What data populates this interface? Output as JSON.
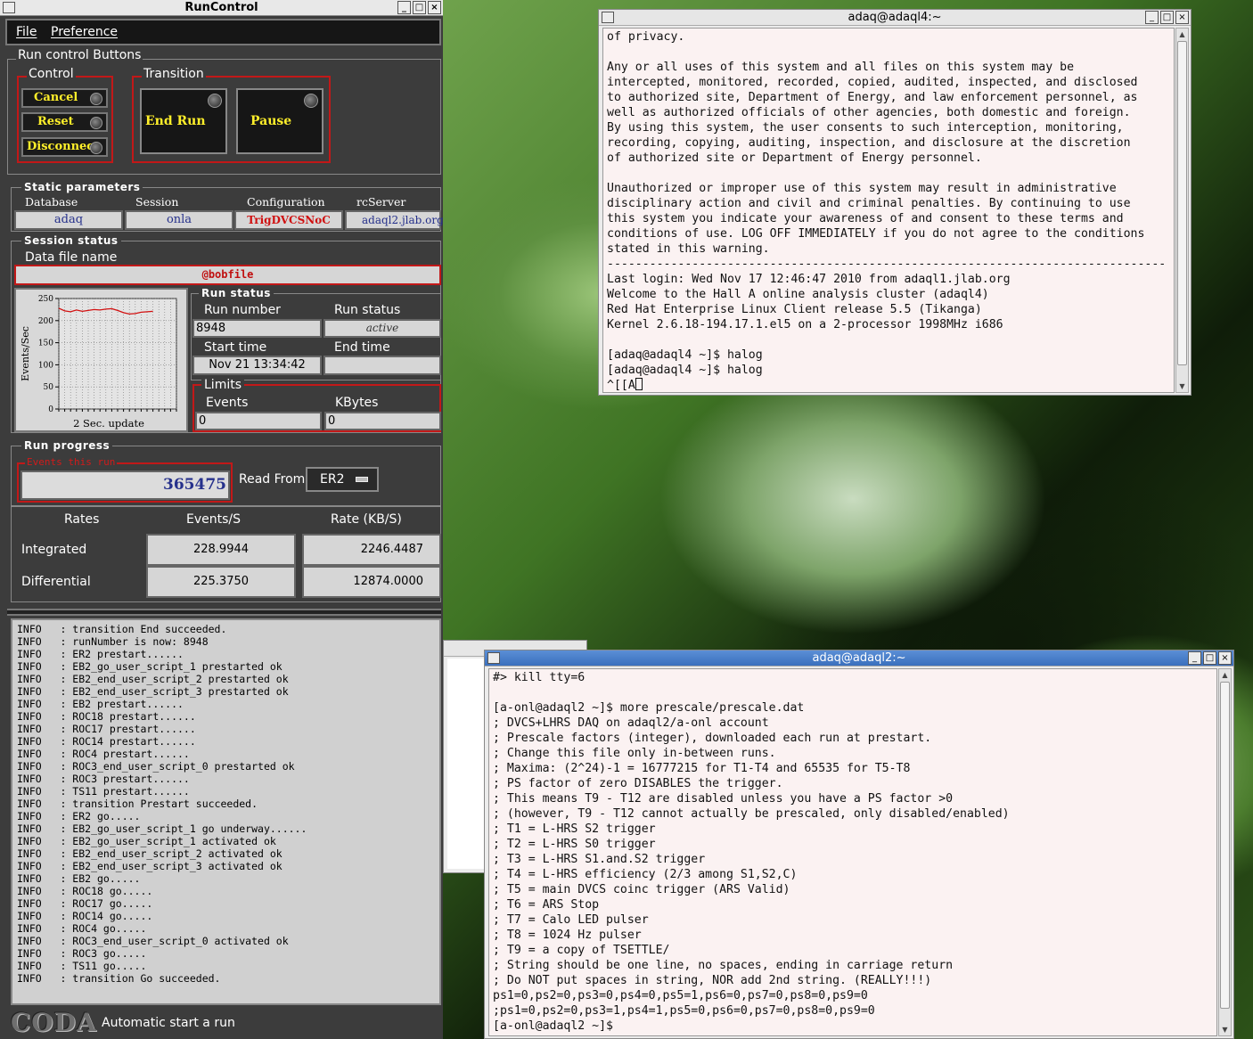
{
  "runcontrol": {
    "title": "RunControl",
    "menu": [
      "File",
      "Preference"
    ],
    "run_control_buttons": "Run control Buttons",
    "control": {
      "label": "Control",
      "buttons": [
        "Cancel",
        "Reset",
        "Disconnect"
      ]
    },
    "transition": {
      "label": "Transition",
      "buttons": [
        "End Run",
        "Pause"
      ]
    },
    "static_params": {
      "label": "Static parameters",
      "database_label": "Database",
      "database": "adaq",
      "session_label": "Session",
      "session": "onla",
      "config_label": "Configuration",
      "config": "TrigDVCSNoC",
      "rcserver_label": "rcServer",
      "rcserver": "adaql2.jlab.org"
    },
    "session_status": {
      "label": "Session status",
      "datafile_label": "Data file name",
      "datafile": "@bobfile"
    },
    "chart": {
      "ylabel": "Events/Sec",
      "footer": "2 Sec. update"
    },
    "run_status": {
      "label": "Run status",
      "run_number_label": "Run number",
      "run_number": "8948",
      "status_label": "Run status",
      "status": "active",
      "start_label": "Start time",
      "start": "Nov 21 13:34:42",
      "end_label": "End time",
      "end": "",
      "limits_label": "Limits",
      "events_label": "Events",
      "events": "0",
      "kbytes_label": "KBytes",
      "kbytes": "0"
    },
    "run_progress": {
      "label": "Run progress",
      "events_label": "Events this run",
      "events": "365475",
      "read_from_label": "Read From:",
      "read_from": "ER2"
    },
    "rates": {
      "header": [
        "Rates",
        "Events/S",
        "Rate (KB/S)"
      ],
      "rows": [
        {
          "name": "Integrated",
          "events": "228.9944",
          "rate": "2246.4487"
        },
        {
          "name": "Differential",
          "events": "225.3750",
          "rate": "12874.0000"
        }
      ]
    },
    "log": [
      "INFO   : transition End succeeded.",
      "INFO   : runNumber is now: 8948",
      "INFO   : ER2 prestart......",
      "INFO   : EB2_go_user_script_1 prestarted ok",
      "INFO   : EB2_end_user_script_2 prestarted ok",
      "INFO   : EB2_end_user_script_3 prestarted ok",
      "INFO   : EB2 prestart......",
      "INFO   : ROC18 prestart......",
      "INFO   : ROC17 prestart......",
      "INFO   : ROC14 prestart......",
      "INFO   : ROC4 prestart......",
      "INFO   : ROC3_end_user_script_0 prestarted ok",
      "INFO   : ROC3 prestart......",
      "INFO   : TS11 prestart......",
      "INFO   : transition Prestart succeeded.",
      "INFO   : ER2 go.....",
      "INFO   : EB2_go_user_script_1 go underway......",
      "INFO   : EB2_go_user_script_1 activated ok",
      "INFO   : EB2_end_user_script_2 activated ok",
      "INFO   : EB2_end_user_script_3 activated ok",
      "INFO   : EB2 go.....",
      "INFO   : ROC18 go.....",
      "INFO   : ROC17 go.....",
      "INFO   : ROC14 go.....",
      "INFO   : ROC4 go.....",
      "INFO   : ROC3_end_user_script_0 activated ok",
      "INFO   : ROC3 go.....",
      "INFO   : TS11 go.....",
      "INFO   : transition Go succeeded."
    ],
    "coda_logo": "CODA",
    "footer_status": "Automatic start a run"
  },
  "chart_data": {
    "type": "line",
    "x": [
      0,
      1,
      2,
      3,
      4,
      5,
      6,
      7,
      8,
      9,
      10,
      11,
      12,
      13,
      14,
      15,
      16,
      17,
      18,
      19,
      20
    ],
    "values": [
      228,
      222,
      220,
      224,
      221,
      223,
      225,
      224,
      226,
      227,
      223,
      218,
      215,
      216,
      219,
      220,
      221
    ],
    "ylabel": "Events/Sec",
    "xlabel": "2 Sec. update",
    "ylim": [
      0,
      250
    ],
    "yticks": [
      0,
      50,
      100,
      150,
      200,
      250
    ],
    "grid": true
  },
  "term1": {
    "title": "adaq@adaql4:~",
    "lines": [
      "of privacy.",
      "",
      "Any or all uses of this system and all files on this system may be",
      "intercepted, monitored, recorded, copied, audited, inspected, and disclosed",
      "to authorized site, Department of Energy, and law enforcement personnel, as",
      "well as authorized officials of other agencies, both domestic and foreign.",
      "By using this system, the user consents to such interception, monitoring,",
      "recording, copying, auditing, inspection, and disclosure at the discretion",
      "of authorized site or Department of Energy personnel.",
      "",
      "Unauthorized or improper use of this system may result in administrative",
      "disciplinary action and civil and criminal penalties. By continuing to use",
      "this system you indicate your awareness of and consent to these terms and",
      "conditions of use. LOG OFF IMMEDIATELY if you do not agree to the conditions",
      "stated in this warning.",
      "-------------------------------------------------------------------------------",
      "Last login: Wed Nov 17 12:46:47 2010 from adaql1.jlab.org",
      "Welcome to the Hall A online analysis cluster (adaql4)",
      "Red Hat Enterprise Linux Client release 5.5 (Tikanga)",
      "Kernel 2.6.18-194.17.1.el5 on a 2-processor 1998MHz i686",
      "",
      "[adaq@adaql4 ~]$ halog",
      "[adaq@adaql4 ~]$ halog",
      "^[[A"
    ]
  },
  "term2": {
    "title": "adaq@adaql2:~",
    "lines": [
      "#> kill tty=6",
      "",
      "[a-onl@adaql2 ~]$ more prescale/prescale.dat",
      "; DVCS+LHRS DAQ on adaql2/a-onl account",
      "; Prescale factors (integer), downloaded each run at prestart.",
      "; Change this file only in-between runs.",
      "; Maxima: (2^24)-1 = 16777215 for T1-T4 and 65535 for T5-T8",
      "; PS factor of zero DISABLES the trigger.",
      "; This means T9 - T12 are disabled unless you have a PS factor >0",
      "; (however, T9 - T12 cannot actually be prescaled, only disabled/enabled)",
      "; T1 = L-HRS S2 trigger",
      "; T2 = L-HRS S0 trigger",
      "; T3 = L-HRS S1.and.S2 trigger",
      "; T4 = L-HRS efficiency (2/3 among S1,S2,C)",
      "; T5 = main DVCS coinc trigger (ARS Valid)",
      "; T6 = ARS Stop",
      "; T7 = Calo LED pulser",
      "; T8 = 1024 Hz pulser",
      "; T9 = a copy of TSETTLE/",
      "; String should be one line, no spaces, ending in carriage return",
      "; Do NOT put spaces in string, NOR add 2nd string. (REALLY!!!)",
      "ps1=0,ps2=0,ps3=0,ps4=0,ps5=1,ps6=0,ps7=0,ps8=0,ps9=0",
      ";ps1=0,ps2=0,ps3=1,ps4=1,ps5=0,ps6=0,ps7=0,ps8=0,ps9=0",
      "[a-onl@adaql2 ~]$"
    ]
  }
}
